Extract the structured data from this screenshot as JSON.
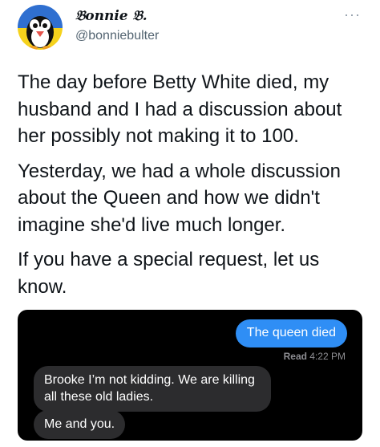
{
  "author": {
    "display_name": "𝔅onnie 𝔅.",
    "handle": "@bonniebulter",
    "avatar_icon": "penguin-avatar-icon"
  },
  "more_icon": "more-options-icon",
  "more_label": "···",
  "tweet": {
    "paragraphs": [
      "The day before Betty White died, my husband and I had a discussion about her possibly not making it to 100.",
      "Yesterday, we had a whole discussion about the Queen and how we didn't imagine she'd live much longer.",
      "If you have a special request, let us know."
    ]
  },
  "screenshot": {
    "sent_message": "The queen died",
    "read_label": "Read",
    "read_time": "4:22 PM",
    "received_messages": [
      "Brooke I’m not kidding. We are killing all these old ladies.",
      "Me and you."
    ]
  },
  "colors": {
    "sent_bubble": "#2f8ef5",
    "received_bubble": "#2c2c2e",
    "avatar_top": "#2f6fd0",
    "avatar_bottom": "#f5d21c"
  }
}
